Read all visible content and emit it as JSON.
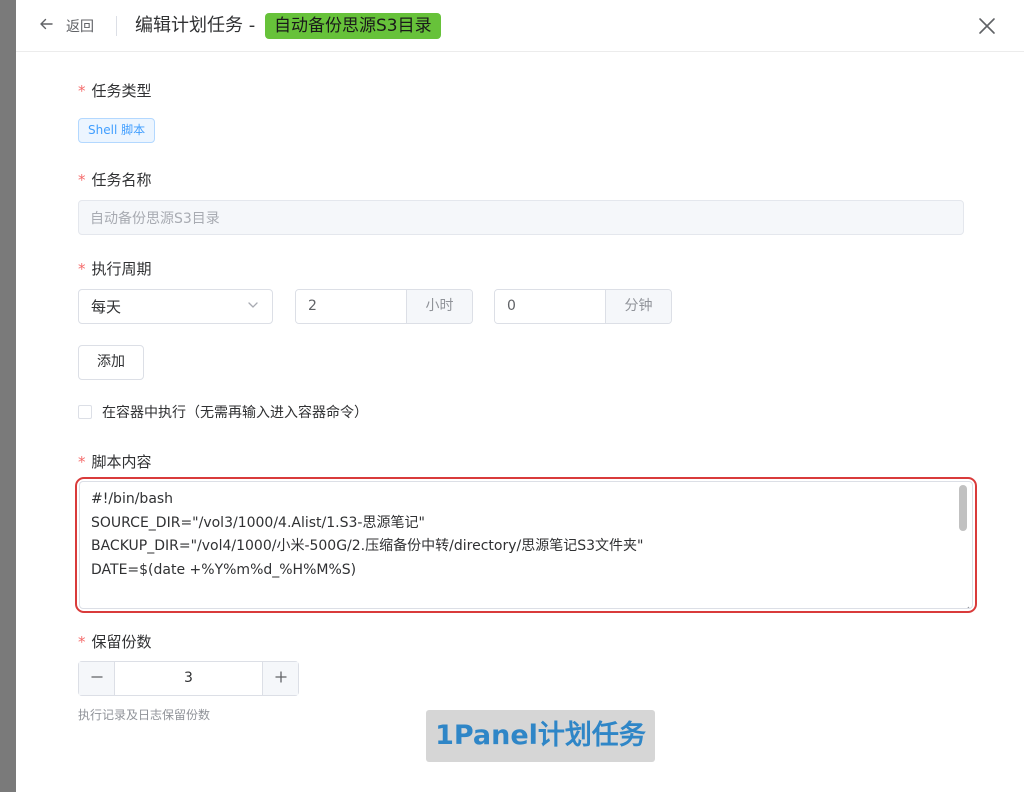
{
  "header": {
    "back_label": "返回",
    "title": "编辑计划任务 -",
    "task_tag": "自动备份思源S3目录"
  },
  "form": {
    "task_type": {
      "label": "任务类型",
      "value": "Shell 脚本"
    },
    "task_name": {
      "label": "任务名称",
      "value": "自动备份思源S3目录"
    },
    "schedule": {
      "label": "执行周期",
      "frequency": "每天",
      "hour_value": "2",
      "hour_unit": "小时",
      "minute_value": "0",
      "minute_unit": "分钟",
      "add_label": "添加"
    },
    "container_exec": {
      "label": "在容器中执行（无需再输入进入容器命令）",
      "checked": false
    },
    "script": {
      "label": "脚本内容",
      "lines": [
        "#!/bin/bash",
        "",
        "SOURCE_DIR=\"/vol3/1000/4.Alist/1.S3-思源笔记\"",
        "BACKUP_DIR=\"/vol4/1000/小米-500G/2.压缩备份中转/directory/思源笔记S3文件夹\"",
        "DATE=$(date +%Y%m%d_%H%M%S)"
      ]
    },
    "retention": {
      "label": "保留份数",
      "value": "3",
      "help": "执行记录及日志保留份数"
    }
  },
  "watermark": "1Panel计划任务",
  "colors": {
    "required": "#f56c6c",
    "title_tag": "#67c23a",
    "highlight": "#d93b3b",
    "type_tag": "#409eff",
    "watermark_text": "#2f86c7"
  }
}
